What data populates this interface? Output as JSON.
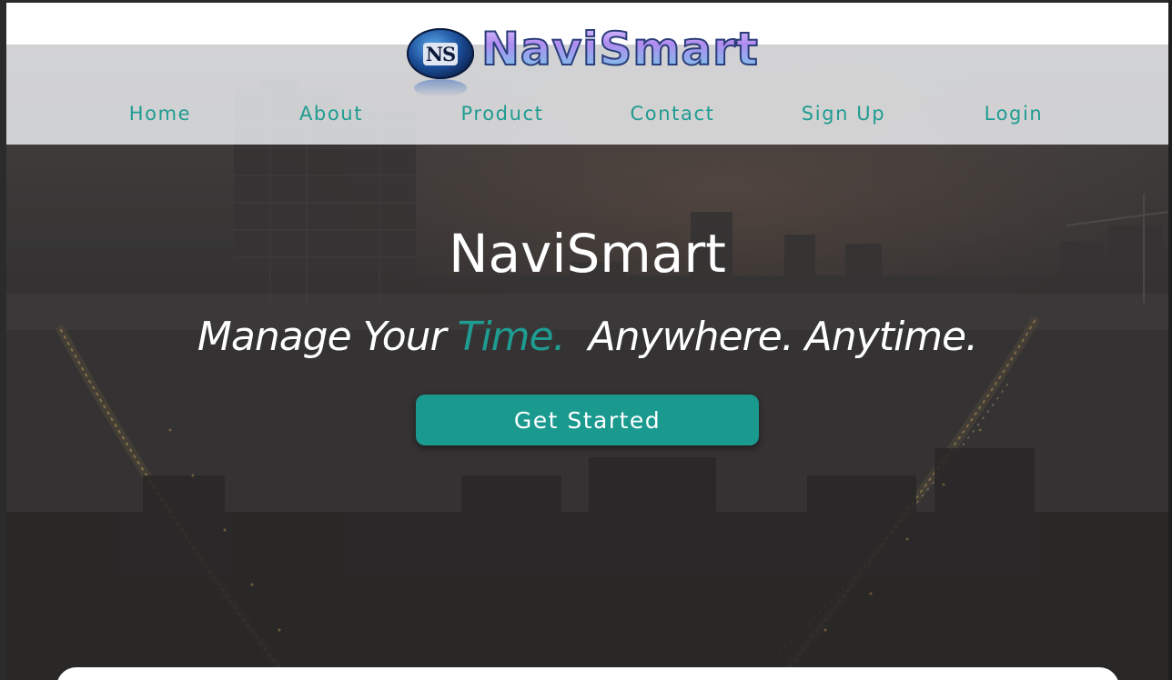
{
  "brand": {
    "logo_badge_text": "NS",
    "logo_text": "NaviSmart"
  },
  "nav": {
    "items": [
      {
        "label": "Home"
      },
      {
        "label": "About"
      },
      {
        "label": "Product"
      },
      {
        "label": "Contact"
      },
      {
        "label": "Sign Up"
      },
      {
        "label": "Login"
      }
    ]
  },
  "hero": {
    "title": "NaviSmart",
    "tagline_part1": "Manage Your ",
    "tagline_accent": "Time.",
    "tagline_part2": "  Anywhere. Anytime.",
    "cta_label": "Get Started"
  },
  "colors": {
    "accent": "#1f9c91",
    "button": "#1a9a8f",
    "logo_purple": "#a98be8"
  },
  "icons": {
    "logo_badge": "ns-emblem-icon"
  }
}
